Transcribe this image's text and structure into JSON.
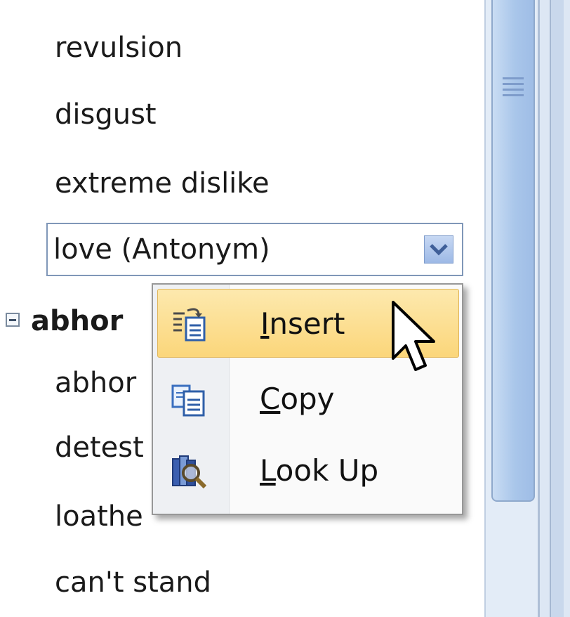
{
  "thesaurus": {
    "items": [
      {
        "label": "revulsion",
        "bold": false
      },
      {
        "label": "disgust",
        "bold": false
      },
      {
        "label": "extreme dislike",
        "bold": false
      },
      {
        "label": "abhor",
        "bold": true
      },
      {
        "label": "abhor",
        "bold": false
      },
      {
        "label": "detest",
        "bold": false
      },
      {
        "label": "loathe",
        "bold": false
      },
      {
        "label": "can't stand",
        "bold": false
      }
    ],
    "selected_combo": {
      "label": "love (Antonym)"
    }
  },
  "context_menu": {
    "items": [
      {
        "label": "Insert",
        "accel": "I",
        "icon": "insert-icon",
        "highlighted": true
      },
      {
        "label": "Copy",
        "accel": "C",
        "icon": "copy-icon",
        "highlighted": false
      },
      {
        "label": "Look Up",
        "accel": "L",
        "icon": "look-up-icon",
        "highlighted": false
      }
    ]
  },
  "colors": {
    "menu_highlight": "#fbd67a",
    "scrollbar_thumb": "#a9c6ea",
    "combo_border": "#8097b8"
  }
}
